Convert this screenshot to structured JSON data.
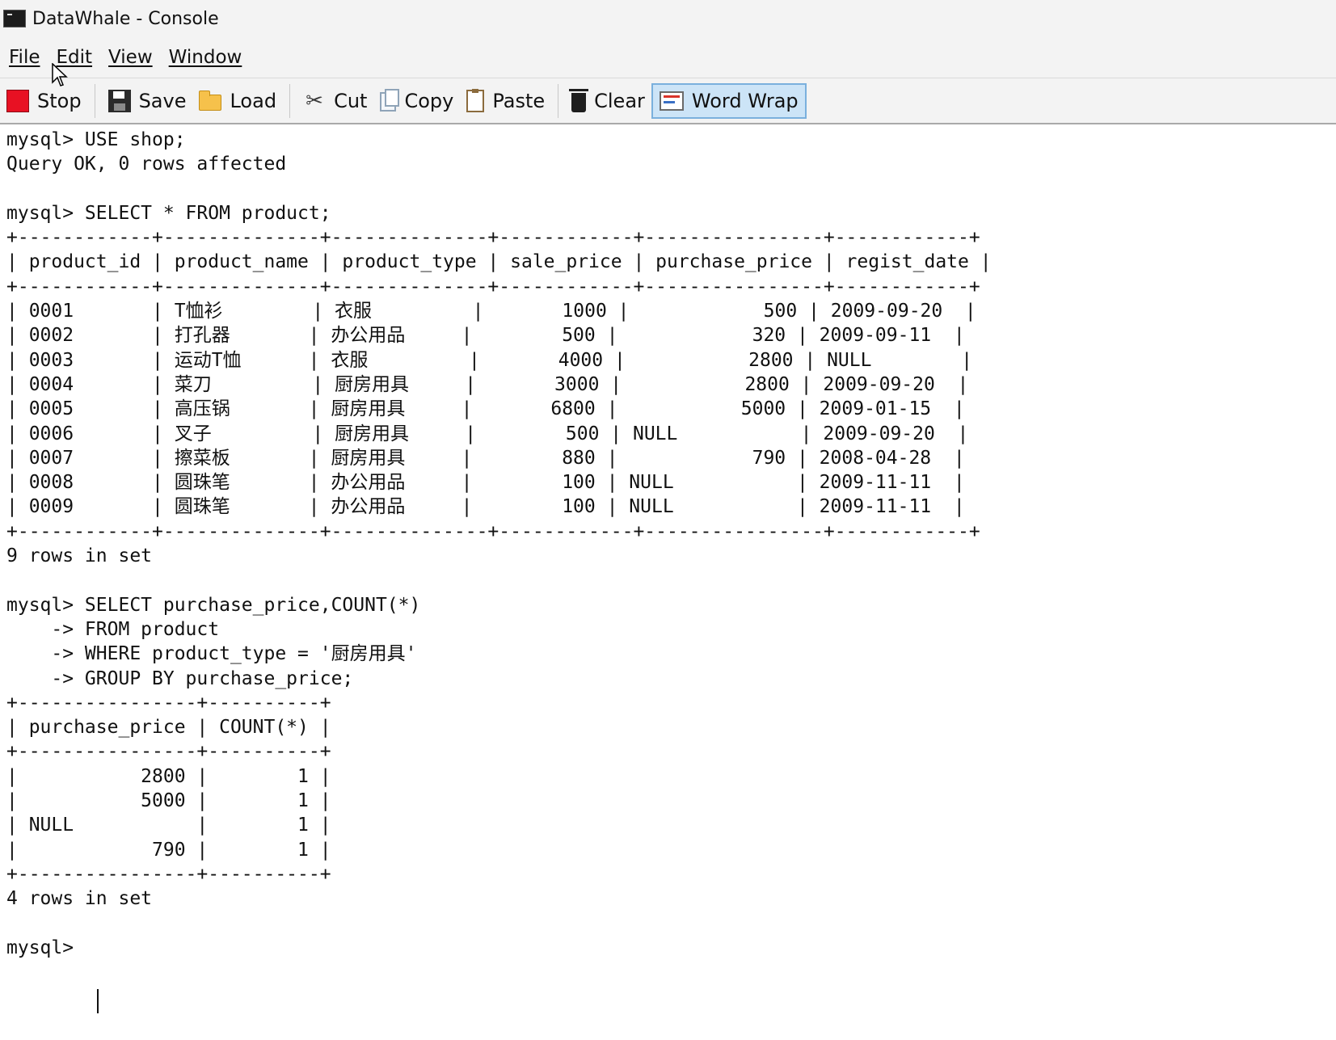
{
  "window": {
    "title": "DataWhale - Console"
  },
  "menu": {
    "file": "File",
    "edit": "Edit",
    "view": "View",
    "window": "Window"
  },
  "toolbar": {
    "stop": "Stop",
    "save": "Save",
    "load": "Load",
    "cut": "Cut",
    "copy": "Copy",
    "paste": "Paste",
    "clear": "Clear",
    "word_wrap": "Word Wrap"
  },
  "icons": {
    "stop": "stop-icon",
    "save": "floppy-disk-icon",
    "load": "folder-icon",
    "cut": "scissors-icon",
    "copy": "copy-icon",
    "paste": "clipboard-icon",
    "clear": "trash-icon",
    "word_wrap": "word-wrap-icon"
  },
  "console": {
    "text": "mysql> USE shop;\nQuery OK, 0 rows affected\n\nmysql> SELECT * FROM product;\n+------------+--------------+--------------+------------+----------------+------------+\n| product_id | product_name | product_type | sale_price | purchase_price | regist_date |\n+------------+--------------+--------------+------------+----------------+------------+\n| 0001       | T恤衫        | 衣服         |       1000 |            500 | 2009-09-20  |\n| 0002       | 打孔器       | 办公用品     |        500 |            320 | 2009-09-11  |\n| 0003       | 运动T恤      | 衣服         |       4000 |           2800 | NULL        |\n| 0004       | 菜刀         | 厨房用具     |       3000 |           2800 | 2009-09-20  |\n| 0005       | 高压锅       | 厨房用具     |       6800 |           5000 | 2009-01-15  |\n| 0006       | 叉子         | 厨房用具     |        500 | NULL           | 2009-09-20  |\n| 0007       | 擦菜板       | 厨房用具     |        880 |            790 | 2008-04-28  |\n| 0008       | 圆珠笔       | 办公用品     |        100 | NULL           | 2009-11-11  |\n| 0009       | 圆珠笔       | 办公用品     |        100 | NULL           | 2009-11-11  |\n+------------+--------------+--------------+------------+----------------+------------+\n9 rows in set\n\nmysql> SELECT purchase_price,COUNT(*)\n    -> FROM product\n    -> WHERE product_type = '厨房用具'\n    -> GROUP BY purchase_price;\n+----------------+----------+\n| purchase_price | COUNT(*) |\n+----------------+----------+\n|           2800 |        1 |\n|           5000 |        1 |\n| NULL           |        1 |\n|            790 |        1 |\n+----------------+----------+\n4 rows in set\n\nmysql> "
  }
}
